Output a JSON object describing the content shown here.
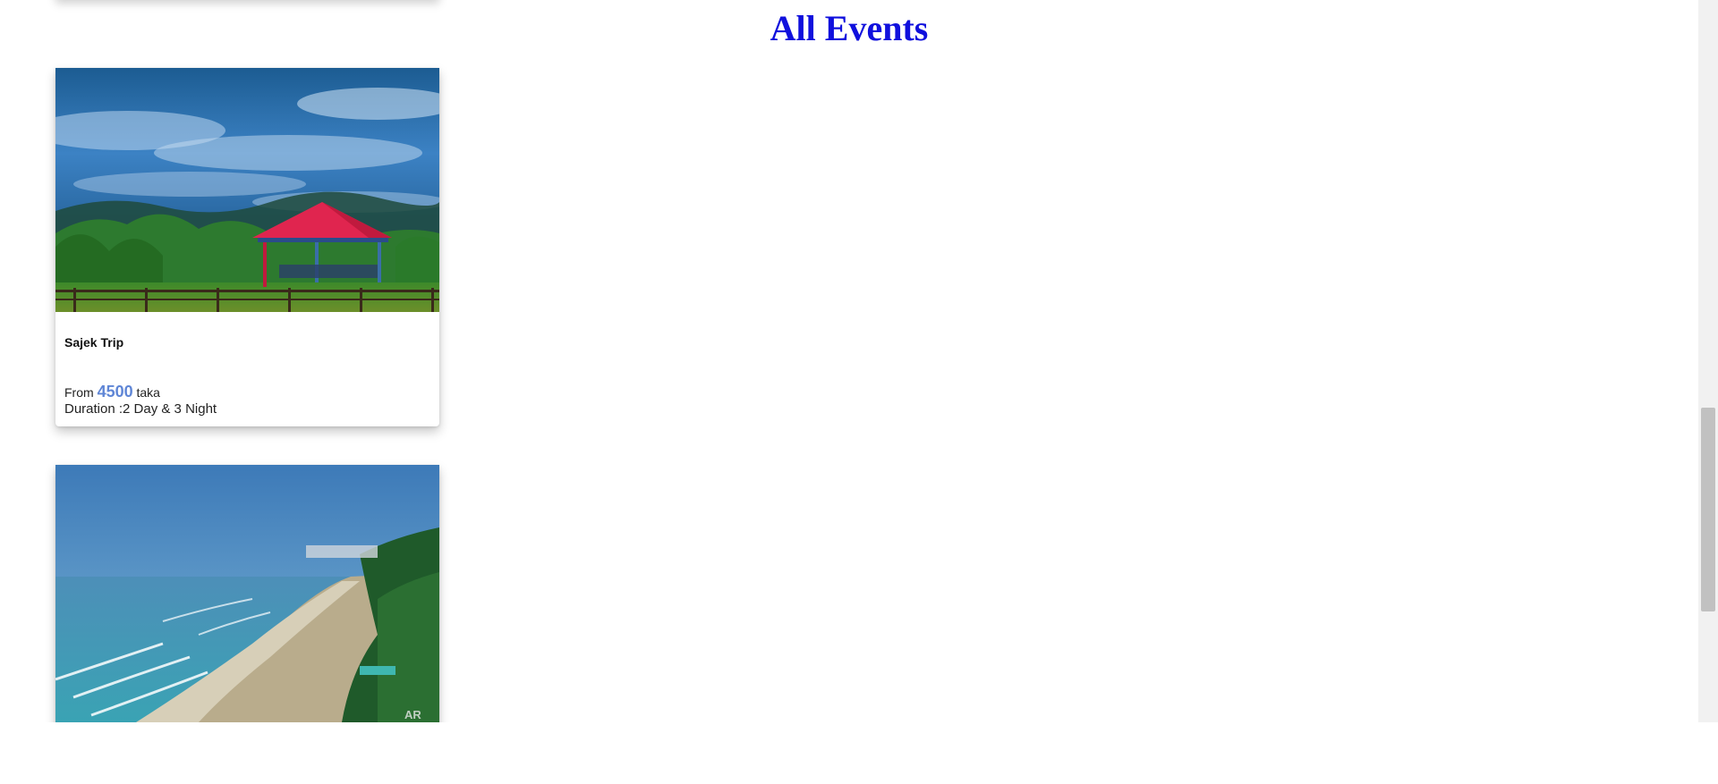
{
  "page": {
    "title": "All Events"
  },
  "events": [
    {
      "name": "Sajek Trip",
      "price_prefix": "From",
      "price": "4500",
      "price_suffix": "taka",
      "duration": "Duration :2 Day & 3 Night",
      "image": "mountain-gazebo-image"
    },
    {
      "image": "beach-coastline-image",
      "watermark": "AR"
    }
  ],
  "colors": {
    "title": "#1010dd",
    "price": "#5f86d6"
  }
}
